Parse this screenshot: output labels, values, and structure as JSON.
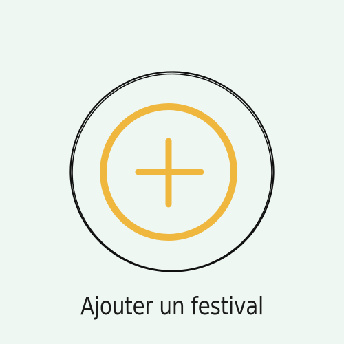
{
  "background_color": "#eef7f1",
  "action": {
    "label": "Ajouter un festival",
    "icon": "plus-circle-icon",
    "icon_color": "#efb73e",
    "ring_color": "#111111",
    "text_color": "#1b1b1b"
  }
}
